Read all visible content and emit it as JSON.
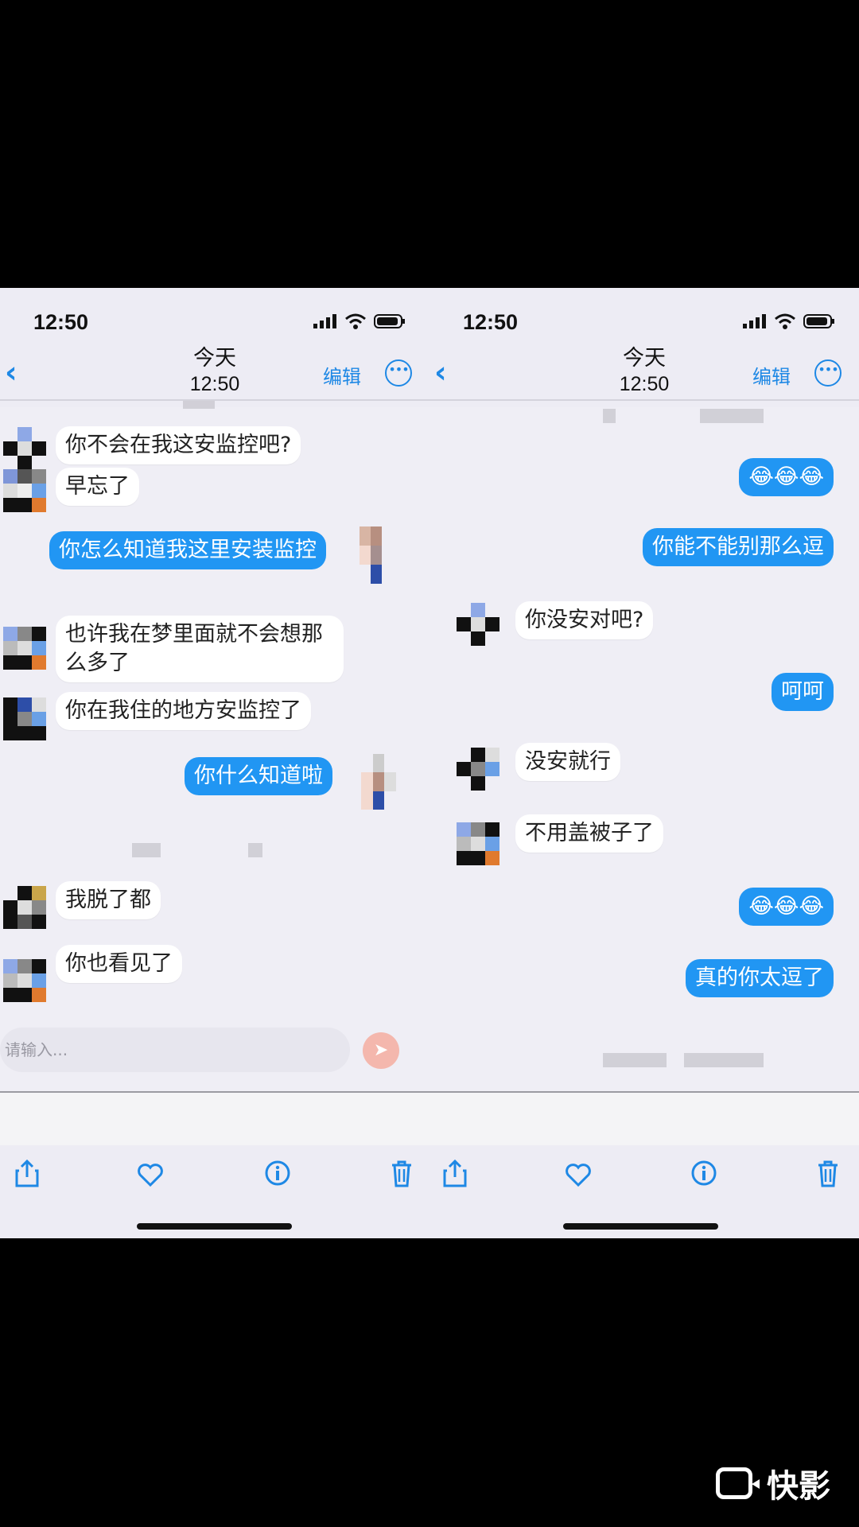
{
  "left": {
    "status_time": "12:50",
    "nav": {
      "title": "今天",
      "subtitle": "12:50",
      "edit": "编辑"
    },
    "messages": [
      "你不会在我这安监控吧?",
      "早忘了",
      "你怎么知道我这里安装监控",
      "也许我在梦里面就不会想那\n么多了",
      "你在我住的地方安监控了",
      "你什么知道啦",
      "我脱了都",
      "你也看见了"
    ],
    "input_placeholder": "请输入..."
  },
  "right": {
    "status_time": "12:50",
    "nav": {
      "title": "今天",
      "subtitle": "12:50",
      "edit": "编辑"
    },
    "messages": [
      "😂😂😂",
      "你能不能别那么逗",
      "你没安对吧?",
      "呵呵",
      "没安就行",
      "不用盖被子了",
      "😂😂😂",
      "真的你太逗了"
    ]
  },
  "watermark": "快影",
  "colors": {
    "accent": "#2196f3",
    "background": "#000000"
  }
}
